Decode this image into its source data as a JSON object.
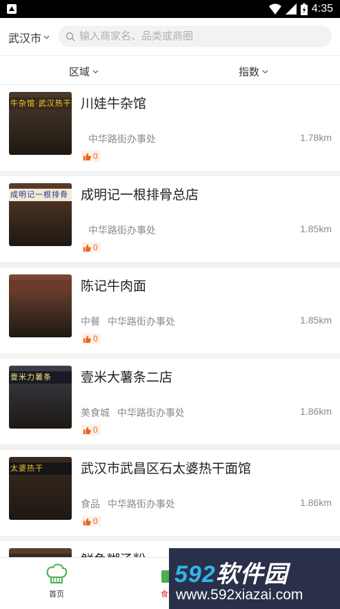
{
  "status_bar": {
    "time": "4:35"
  },
  "header": {
    "city": "武汉市",
    "search_placeholder": "输入商家名、品类或商圈"
  },
  "filters": {
    "area": "区域",
    "index": "指数"
  },
  "restaurants": [
    {
      "name": "川娃牛杂馆",
      "category": "",
      "district": "中华路街办事处",
      "distance": "1.78km",
      "likes": "0",
      "sign_text": "牛杂馆·武汉热干",
      "sign_bg": "#3a2a1a",
      "sign_color": "#f2d23a",
      "photo_color": "#4a3a2c"
    },
    {
      "name": "成明记一根排骨总店",
      "category": "",
      "district": "中华路街办事处",
      "distance": "1.85km",
      "likes": "0",
      "sign_text": "成明记一根排骨",
      "sign_bg": "#f3e9d6",
      "sign_color": "#1a3a8a",
      "photo_color": "#5a3b2a"
    },
    {
      "name": "陈记牛肉面",
      "category": "中餐",
      "district": "中华路街办事处",
      "distance": "1.85km",
      "likes": "0",
      "sign_text": "",
      "sign_bg": "#6b3a2a",
      "sign_color": "#ffffff",
      "photo_color": "#7a4a36"
    },
    {
      "name": "壹米大薯条二店",
      "category": "美食城",
      "district": "中华路街办事处",
      "distance": "1.86km",
      "likes": "0",
      "sign_text": "壹米力薯条",
      "sign_bg": "#1a1a24",
      "sign_color": "#f5e27a",
      "photo_color": "#3a3f4a"
    },
    {
      "name": "武汉市武昌区石太婆热干面馆",
      "category": "食品",
      "district": "中华路街办事处",
      "distance": "1.86km",
      "likes": "0",
      "sign_text": "太婆热干",
      "sign_bg": "#161616",
      "sign_color": "#f2c230",
      "photo_color": "#3b2a20"
    },
    {
      "name": "鲜鱼糊汤粉",
      "category": "",
      "district": "",
      "distance": "",
      "likes": "",
      "sign_text": "",
      "sign_bg": "#3a2a1a",
      "sign_color": "#ffffff",
      "photo_color": "#5a4030"
    }
  ],
  "tabbar": {
    "home": "首页",
    "canteen": "食堂"
  },
  "watermark": {
    "brand_num": "592",
    "brand_text": "软件园",
    "url": "www.592xiazai.com"
  },
  "colors": {
    "accent": "#e8651c",
    "active_tab": "#d9251d",
    "tab_green": "#4caf50"
  }
}
